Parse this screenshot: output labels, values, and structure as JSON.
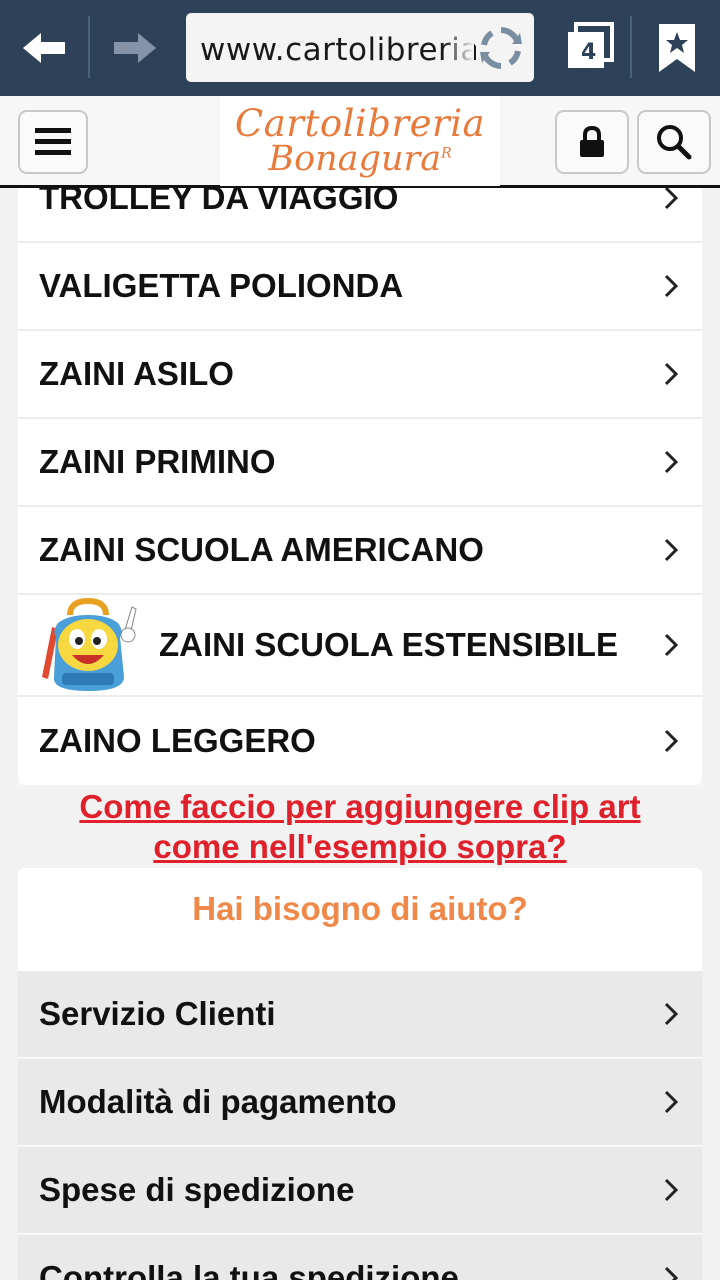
{
  "browser": {
    "url": "www.cartolibreria.",
    "tab_count": "4",
    "icons": {
      "back": "back-arrow-icon",
      "forward": "forward-arrow-icon",
      "refresh": "refresh-icon",
      "tabs": "tabs-icon",
      "bookmarks": "bookmark-star-icon"
    }
  },
  "header": {
    "logo_line1": "Cartolibreria",
    "logo_line2": "Bonagura",
    "logo_mark": "R",
    "icons": {
      "menu": "hamburger-menu-icon",
      "account": "lock-icon",
      "search": "search-icon"
    }
  },
  "categories": [
    {
      "label": "TROLLEY DA VIAGGIO"
    },
    {
      "label": "VALIGETTA POLIONDA"
    },
    {
      "label": "ZAINI ASILO"
    },
    {
      "label": "ZAINI PRIMINO"
    },
    {
      "label": "ZAINI SCUOLA AMERICANO"
    },
    {
      "label": "ZAINI SCUOLA ESTENSIBILE",
      "icon": "backpack-mascot-icon"
    },
    {
      "label": "ZAINO LEGGERO"
    }
  ],
  "annotation": {
    "line1": "Come faccio per aggiungere clip art ",
    "line2": "come nell'esempio sopra?"
  },
  "help": {
    "title": "Hai bisogno di aiuto?",
    "items": [
      {
        "label": "Servizio Clienti"
      },
      {
        "label": "Modalità di pagamento"
      },
      {
        "label": "Spese di spedizione"
      },
      {
        "label": "Controlla la tua spedizione"
      }
    ]
  },
  "colors": {
    "browser_bar": "#2d4259",
    "logo": "#e87a3c",
    "annotation": "#e0202a",
    "help_title": "#f0884a"
  }
}
